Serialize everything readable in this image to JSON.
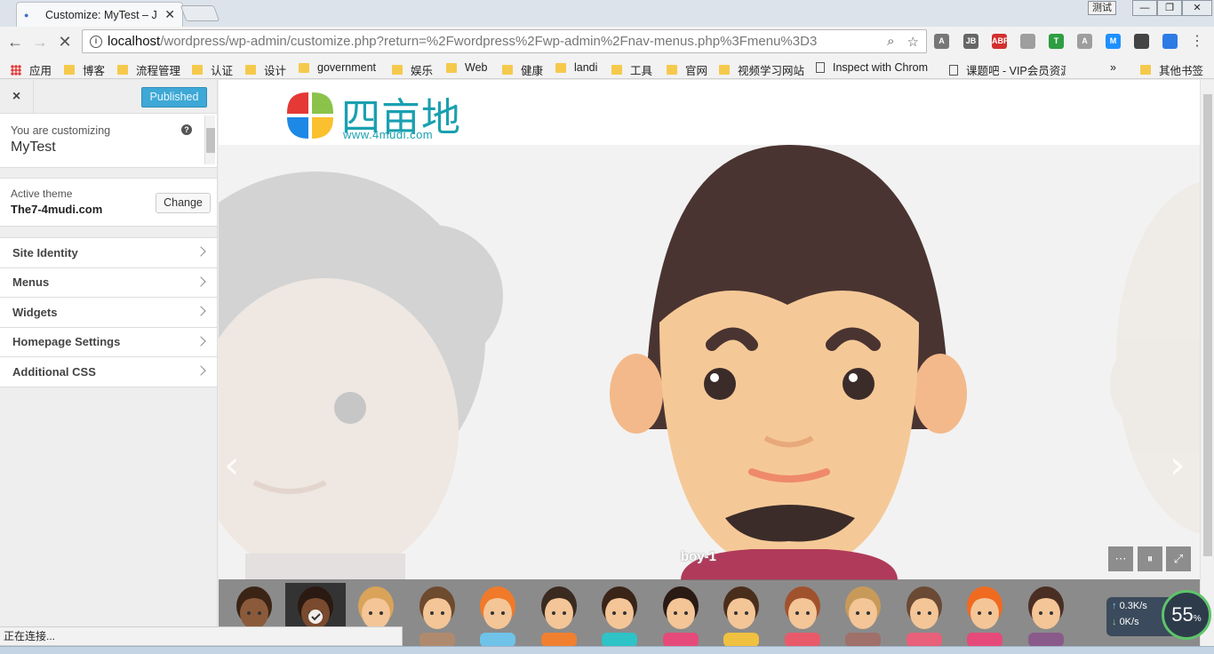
{
  "browser": {
    "tab_title": "Customize: MyTest – J",
    "user_label": "测试",
    "url_host": "localhost",
    "url_path": "/wordpress/wp-admin/customize.php?return=%2Fwordpress%2Fwp-admin%2Fnav-menus.php%3Fmenu%3D3",
    "extensions": [
      {
        "name": "angular-ext",
        "label": "A",
        "color": "#777777"
      },
      {
        "name": "jb-ext",
        "label": "JB",
        "color": "#666666"
      },
      {
        "name": "adblock-ext",
        "label": "ABP",
        "color": "#d32f2f"
      },
      {
        "name": "shield-ext",
        "label": "",
        "color": "#9e9e9e"
      },
      {
        "name": "tampermonkey-ext",
        "label": "T",
        "color": "#2e9e42"
      },
      {
        "name": "angular2-ext",
        "label": "A",
        "color": "#9e9e9e"
      },
      {
        "name": "m-ext",
        "label": "M",
        "color": "#1e90ff"
      },
      {
        "name": "pocket-ext",
        "label": "",
        "color": "#444444"
      },
      {
        "name": "shield2-ext",
        "label": "",
        "color": "#2d7be5"
      }
    ],
    "bookmarks": [
      {
        "label": "应用",
        "type": "apps"
      },
      {
        "label": "博客",
        "type": "folder"
      },
      {
        "label": "流程管理",
        "type": "folder"
      },
      {
        "label": "认证",
        "type": "folder"
      },
      {
        "label": "设计",
        "type": "folder"
      },
      {
        "label": "government",
        "type": "folder"
      },
      {
        "label": "娱乐",
        "type": "folder"
      },
      {
        "label": "Web",
        "type": "folder"
      },
      {
        "label": "健康",
        "type": "folder"
      },
      {
        "label": "landi",
        "type": "folder"
      },
      {
        "label": "工具",
        "type": "folder"
      },
      {
        "label": "官网",
        "type": "folder"
      },
      {
        "label": "视频学习网站",
        "type": "folder"
      },
      {
        "label": "Inspect with Chrom",
        "type": "page"
      },
      {
        "label": "课题吧 - VIP会员资源",
        "type": "page"
      }
    ],
    "overflow_label": "»",
    "other_bookmarks": "其他书签",
    "status_text": "正在连接..."
  },
  "sidebar": {
    "close_label": "×",
    "publish_label": "Published",
    "customizing_label": "You are customizing",
    "site_name": "MyTest",
    "active_theme_label": "Active theme",
    "theme_name": "The7-4mudi.com",
    "change_label": "Change",
    "sections": [
      {
        "label": "Site Identity"
      },
      {
        "label": "Menus"
      },
      {
        "label": "Widgets"
      },
      {
        "label": "Homepage Settings"
      },
      {
        "label": "Additional CSS"
      }
    ]
  },
  "preview": {
    "logo_text": "四亩地",
    "logo_url": "www.4mudi.com",
    "slide_caption": "boy-1",
    "prev_arrow": "‹",
    "next_arrow": "›",
    "thumbnails": [
      {
        "name": "curly-hair",
        "hair": "#3b2416",
        "skin": "#8a5a3b",
        "shirt": "#c9a27a"
      },
      {
        "name": "boy-1",
        "hair": "#2a1a12",
        "skin": "#7a4a2e",
        "shirt": "#444444",
        "active": true
      },
      {
        "name": "blond-boy",
        "hair": "#d9a45a",
        "skin": "#f3c597",
        "shirt": "#6aa6d8"
      },
      {
        "name": "brown-boy",
        "hair": "#6e4a2e",
        "skin": "#f3c597",
        "shirt": "#b08a6e"
      },
      {
        "name": "redhead-boy",
        "hair": "#f07a2a",
        "skin": "#f3c597",
        "shirt": "#6fc3e8"
      },
      {
        "name": "dark-boy",
        "hair": "#3a2a20",
        "skin": "#f3c597",
        "shirt": "#f08030"
      },
      {
        "name": "teal-girl",
        "hair": "#3a2418",
        "skin": "#f3c597",
        "shirt": "#2ec3c7"
      },
      {
        "name": "pink-girl",
        "hair": "#2a1a14",
        "skin": "#f3c597",
        "shirt": "#e64a7a"
      },
      {
        "name": "yellow-girl",
        "hair": "#4a2e1c",
        "skin": "#f3c597",
        "shirt": "#f0c040"
      },
      {
        "name": "curly-girl",
        "hair": "#a0522d",
        "skin": "#f3c597",
        "shirt": "#e85a6a"
      },
      {
        "name": "blond-girl",
        "hair": "#c89a5a",
        "skin": "#f3c597",
        "shirt": "#a0706a"
      },
      {
        "name": "bob-girl",
        "hair": "#6a4a34",
        "skin": "#f3c597",
        "shirt": "#e8607a"
      },
      {
        "name": "orange-girl",
        "hair": "#f06a20",
        "skin": "#f3c597",
        "shirt": "#e64a7a"
      },
      {
        "name": "brunette-girl",
        "hair": "#4a2e24",
        "skin": "#f3c597",
        "shirt": "#8a5a8a"
      }
    ]
  },
  "netmonitor": {
    "up_rate": "0.3K/s",
    "down_rate": "0K/s",
    "percent": "55",
    "percent_unit": "%"
  }
}
